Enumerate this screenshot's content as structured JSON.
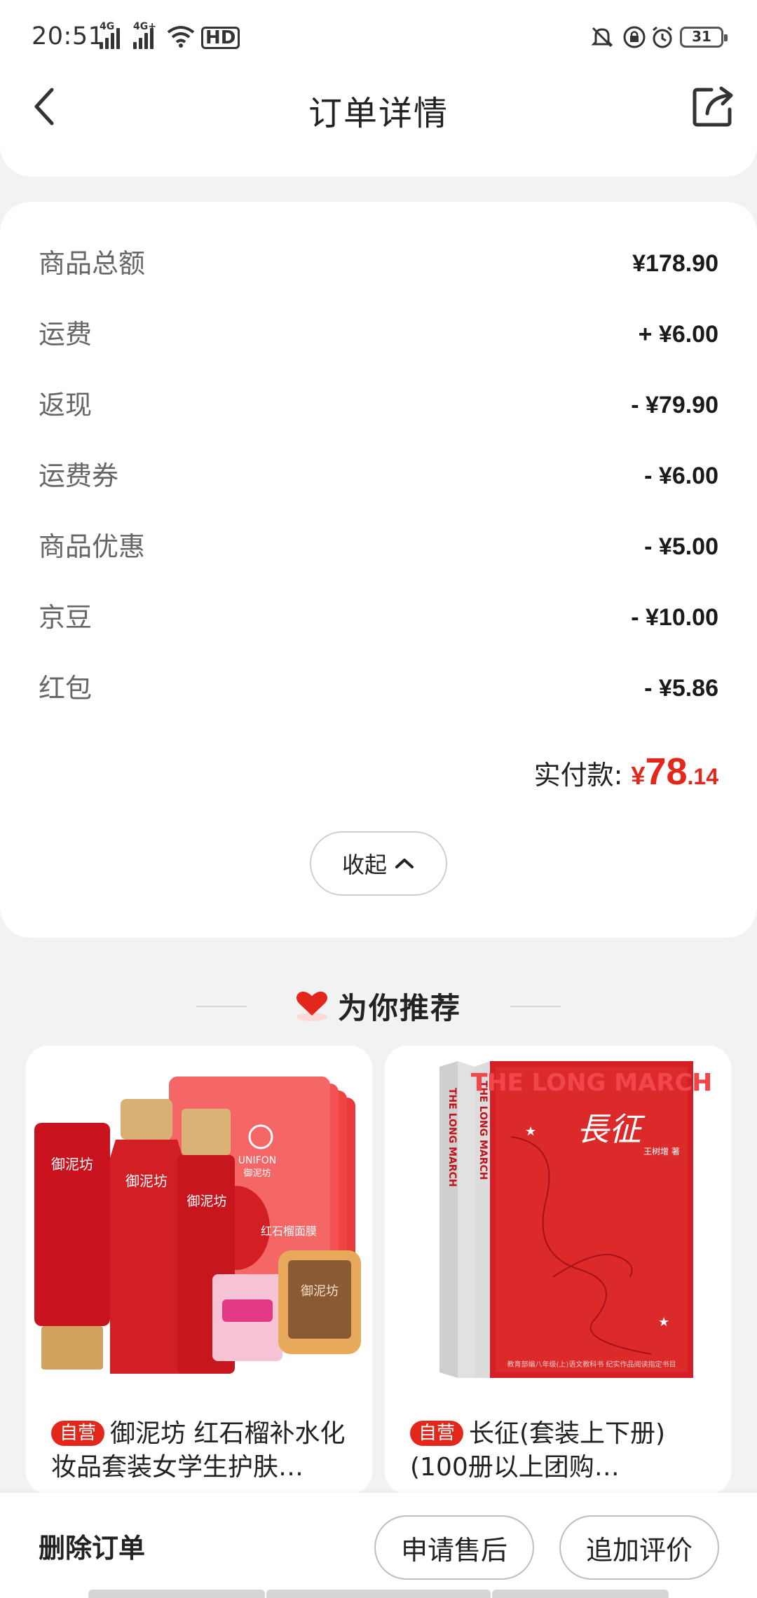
{
  "status_bar": {
    "time": "20:51",
    "net1": "4G",
    "net2": "4G+",
    "hd": "HD",
    "battery": "31"
  },
  "header": {
    "title": "订单详情"
  },
  "price_rows": [
    {
      "label": "商品总额",
      "value": "¥178.90"
    },
    {
      "label": "运费",
      "value": "+ ¥6.00"
    },
    {
      "label": "返现",
      "value": "- ¥79.90"
    },
    {
      "label": "运费券",
      "value": "- ¥6.00"
    },
    {
      "label": "商品优惠",
      "value": "- ¥5.00"
    },
    {
      "label": "京豆",
      "value": "- ¥10.00"
    },
    {
      "label": "红包",
      "value": "- ¥5.86"
    }
  ],
  "paid": {
    "label": "实付款:",
    "symbol": "¥",
    "integer": "78",
    "decimal": ".14"
  },
  "collapse_label": "收起",
  "recommend": {
    "title": "为你推荐",
    "products": [
      {
        "tag": "自营",
        "title": "御泥坊 红石榴补水化妆品套装女学生护肤…",
        "brand_text": "御泥坊",
        "mask_brand": "UNIFON",
        "mask_sub": "御泥坊",
        "mask_line": "红石榴面膜",
        "soap_text": "御泥坊"
      },
      {
        "tag": "自营",
        "title": "长征(套装上下册)(100册以上团购…",
        "cover_en": "THE LONG MARCH",
        "cover_cn": "長征",
        "spine": "THE LONG MARCH",
        "author": "王树增 著",
        "bottom_text": "教育部编八年级(上)语文教科书 纪实作品阅读指定书目"
      }
    ]
  },
  "bottom_bar": {
    "delete_label": "删除订单",
    "after_sale_label": "申请售后",
    "review_label": "追加评价"
  },
  "colors": {
    "accent_red": "#e4271b",
    "background": "#f2f2f2"
  }
}
